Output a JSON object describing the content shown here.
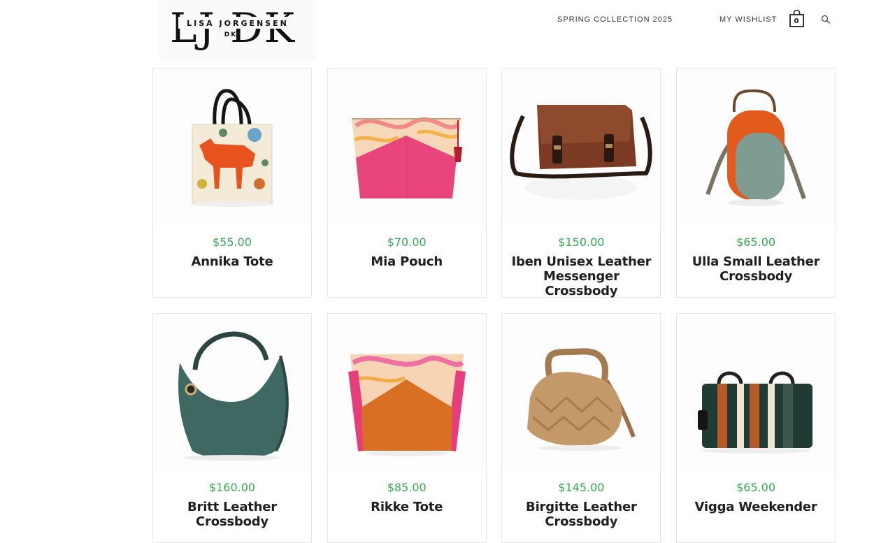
{
  "brand": {
    "logo_letters": "LJ DK",
    "logo_name": "LISA JORGENSEN",
    "logo_sub": "DK"
  },
  "nav": {
    "collection": "SPRING COLLECTION 2025",
    "wishlist": "MY WISHLIST",
    "cart_count": "0"
  },
  "products": [
    {
      "price": "$55.00",
      "title": "Annika Tote"
    },
    {
      "price": "$70.00",
      "title": "Mia Pouch"
    },
    {
      "price": "$150.00",
      "title": "Iben Unisex Leather Messenger Crossbody"
    },
    {
      "price": "$65.00",
      "title": "Ulla Small Leather Crossbody"
    },
    {
      "price": "$160.00",
      "title": "Britt Leather Crossbody"
    },
    {
      "price": "$85.00",
      "title": "Rikke Tote"
    },
    {
      "price": "$145.00",
      "title": "Birgitte Leather Crossbody"
    },
    {
      "price": "$65.00",
      "title": "Vigga Weekender"
    }
  ],
  "colors": {
    "price": "#3aa657",
    "border": "#e6e6e6"
  }
}
